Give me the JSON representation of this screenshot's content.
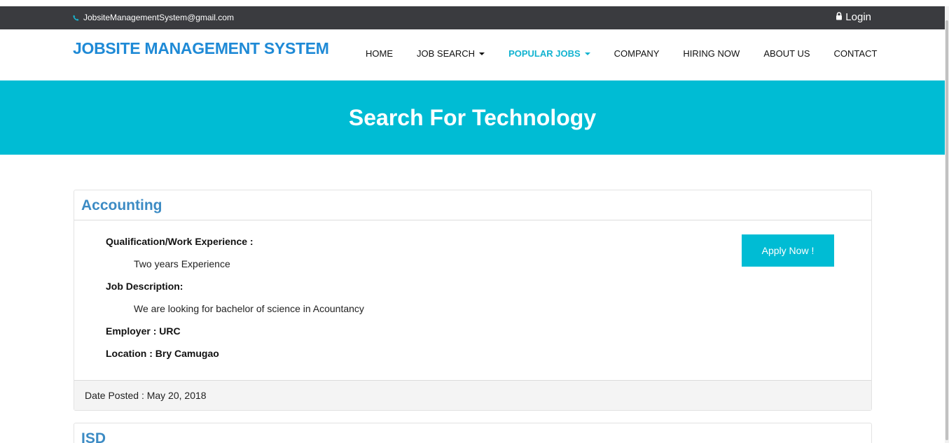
{
  "topbar": {
    "email": "JobsiteManagementSystem@gmail.com",
    "login_label": "Login",
    "icons": {
      "email": "phone-icon",
      "login": "lock-icon"
    }
  },
  "brand": "JOBSITE MANAGEMENT SYSTEM",
  "nav": {
    "items": [
      {
        "label": "HOME"
      },
      {
        "label": "JOB SEARCH",
        "dropdown": true
      },
      {
        "label": "POPULAR JOBS",
        "dropdown": true,
        "active": true
      },
      {
        "label": "COMPANY"
      },
      {
        "label": "HIRING NOW"
      },
      {
        "label": "ABOUT US"
      },
      {
        "label": "CONTACT"
      }
    ]
  },
  "hero": {
    "title": "Search For Technology"
  },
  "jobs": [
    {
      "title": "Accounting",
      "qualification_label": "Qualification/Work Experience :",
      "qualification": "Two years Experience",
      "description_label": "Job Description:",
      "description": "We are looking for bachelor of science in Acountancy",
      "employer": "Employer : URC",
      "location": "Location : Bry Camugao",
      "apply_label": "Apply Now !",
      "date_posted": "Date Posted : May 20, 2018"
    },
    {
      "title": "ISD"
    }
  ],
  "colors": {
    "accent": "#00bcd4",
    "brand": "#1f8ad6",
    "topbar": "#3a3b3f",
    "panel_title": "#3c8bc4"
  }
}
